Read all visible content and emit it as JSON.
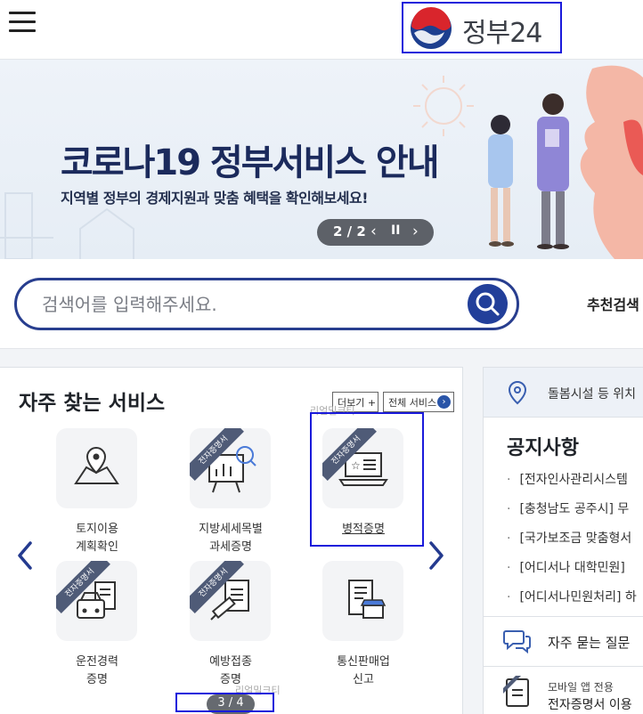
{
  "header": {
    "logo_text": "정부24",
    "menu_icon": "hamburger-menu-icon"
  },
  "banner": {
    "title": "코로나19 정부서비스 안내",
    "subtitle": "지역별 정부의 경제지원과 맞춤 혜택을 확인해보세요!",
    "slide_counter": "2 / 2",
    "prev": "‹",
    "pause": "II",
    "next": "›"
  },
  "search": {
    "placeholder": "검색어를 입력해주세요.",
    "recommend_label": "추천검색"
  },
  "services": {
    "title": "자주 찾는 서비스",
    "more_label": "더보기 +",
    "all_label": "전체 서비스",
    "ghost_label_top": "리얼밀크티",
    "ghost_label_bottom": "리얼밀크티",
    "badge_text": "전자증명서",
    "items": [
      {
        "label": "토지이용\n계획확인",
        "icon": "map-pin-icon",
        "badge": false
      },
      {
        "label": "지방세세목별\n과세증명",
        "icon": "chart-board-icon",
        "badge": true
      },
      {
        "label": "병적증명",
        "icon": "laptop-certificate-icon",
        "badge": true
      },
      {
        "label": "운전경력\n증명",
        "icon": "car-document-icon",
        "badge": true
      },
      {
        "label": "예방접종\n증명",
        "icon": "syringe-document-icon",
        "badge": true
      },
      {
        "label": "통신판매업\n신고",
        "icon": "shop-document-icon",
        "badge": false
      }
    ],
    "page_indicator": "3 / 4"
  },
  "side": {
    "care_text": "돌봄시설 등 위치",
    "notice_title": "공지사항",
    "notices": [
      "[전자인사관리시스템",
      "[충청남도 공주시] 무",
      "[국가보조금 맞춤형서",
      "[어디서나 대학민원]",
      "[어디서나민원처리] 하"
    ],
    "faq_text": "자주 묻는 질문",
    "mobile_line1": "모바일 앱 전용",
    "mobile_line2": "전자증명서 이용"
  },
  "colors": {
    "brand_blue": "#223f9a",
    "highlight": "#1a1adb",
    "ribbon": "#4f5b77"
  }
}
